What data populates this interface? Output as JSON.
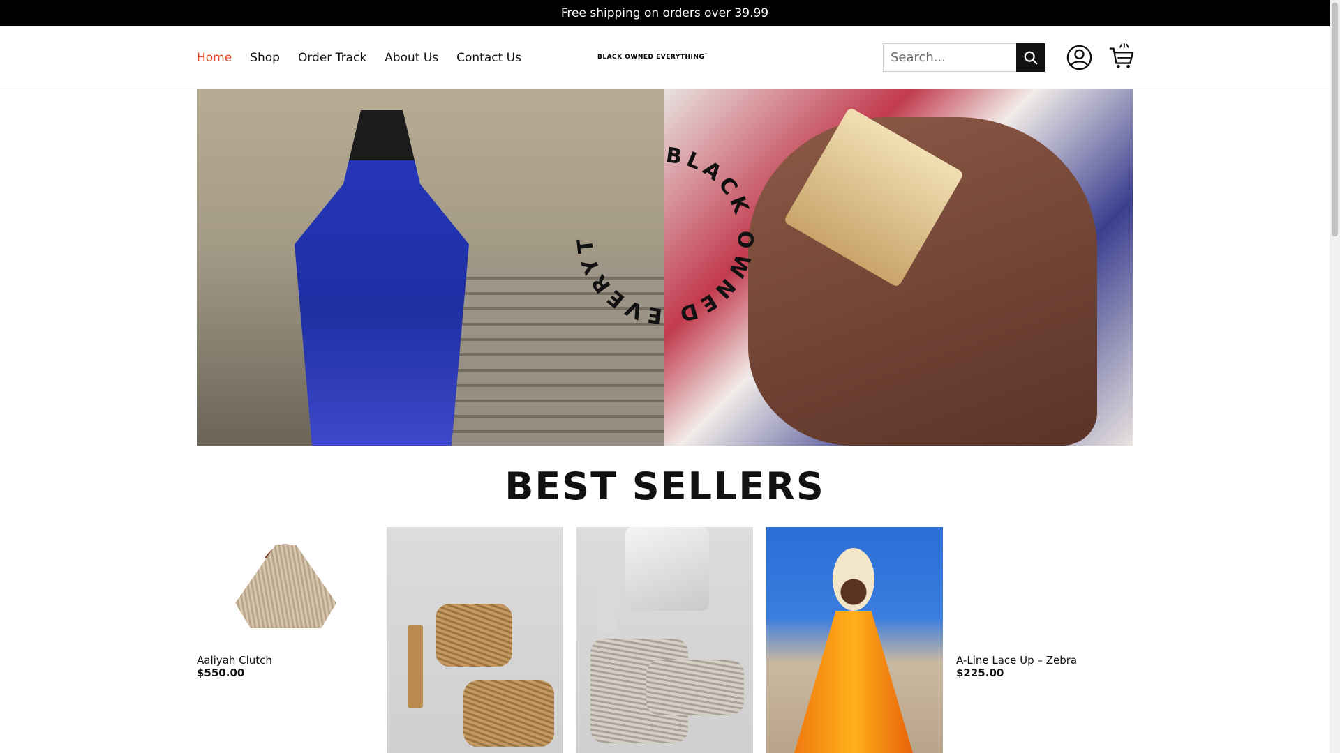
{
  "announcement": "Free shipping on orders over 39.99",
  "nav": {
    "items": [
      {
        "label": "Home",
        "active": true
      },
      {
        "label": "Shop",
        "active": false
      },
      {
        "label": "Order Track",
        "active": false
      },
      {
        "label": "About Us",
        "active": false
      },
      {
        "label": "Contact Us",
        "active": false
      }
    ]
  },
  "logo": {
    "text": "BLACK OWNED EVERYTHING",
    "mark": "™"
  },
  "search": {
    "placeholder": "Search...",
    "icon": "search-icon"
  },
  "header_icons": {
    "account": "user-icon",
    "cart": "cart-icon"
  },
  "hero": {
    "circle_text": "BLACK OWNED EVERYTHING"
  },
  "best_sellers": {
    "title": "BEST SELLERS",
    "products": [
      {
        "name": "Aaliyah Clutch",
        "price": "$550.00"
      },
      {
        "name": "",
        "price": ""
      },
      {
        "name": "",
        "price": ""
      },
      {
        "name": "",
        "price": ""
      },
      {
        "name": "A-Line Lace Up – Zebra",
        "price": "$225.00"
      }
    ]
  },
  "colors": {
    "accent": "#e0471e",
    "announcement_bg": "#000000"
  }
}
